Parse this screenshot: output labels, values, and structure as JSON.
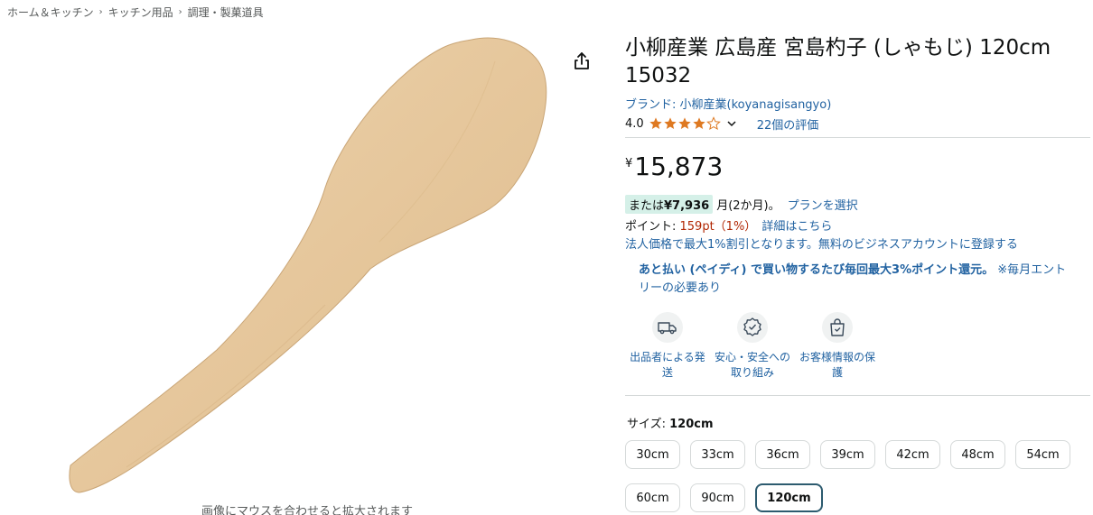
{
  "breadcrumb": [
    "ホーム＆キッチン",
    "キッチン用品",
    "調理・製菓道具"
  ],
  "image_hint": "画像にマウスを合わせると拡大されます",
  "title": "小柳産業 広島産 宮島杓子 (しゃもじ) 120cm 15032",
  "brand": "ブランド: 小柳産業(koyanagisangyo)",
  "rating": {
    "value": "4.0",
    "stars": 4,
    "reviews": "22個の評価"
  },
  "price": {
    "symbol": "¥",
    "amount": "15,873"
  },
  "installment": {
    "prefix": "または",
    "amount": "¥7,936",
    "suffix": "月(2か月)。",
    "plan_link": "プランを選択"
  },
  "points": {
    "label": "ポイント: ",
    "value": "159pt（1%）",
    "link": "詳細はこちら"
  },
  "business": "法人価格で最大1%割引となります。無料のビジネスアカウントに登録する",
  "promo": {
    "strong": "あと払い (ペイディ) で買い物するたび毎回最大3%ポイント還元。",
    "note": "※毎月エントリーの必要あり"
  },
  "features": [
    {
      "icon": "truck-icon",
      "label": "出品者による発送"
    },
    {
      "icon": "badge-check-icon",
      "label": "安心・安全への取り組み"
    },
    {
      "icon": "secure-bag-icon",
      "label": "お客様情報の保護"
    }
  ],
  "size": {
    "label": "サイズ: ",
    "selected": "120cm",
    "options": [
      "30cm",
      "33cm",
      "36cm",
      "39cm",
      "42cm",
      "48cm",
      "54cm",
      "60cm",
      "90cm",
      "120cm"
    ]
  },
  "colors": {
    "link": "#2162a1",
    "price_red": "#b12704",
    "star": "#de7921",
    "badge_bg": "#d5f0e8",
    "selected_border": "#2d5b6f"
  }
}
